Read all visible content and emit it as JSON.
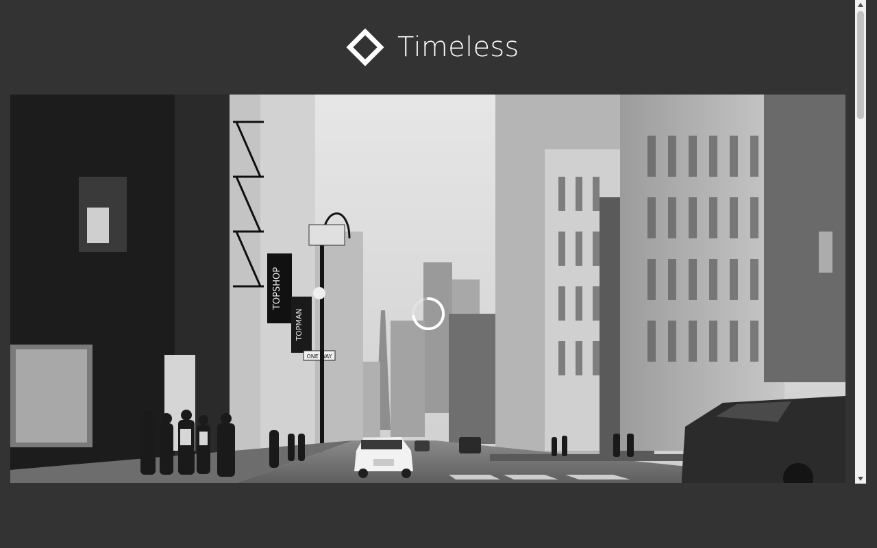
{
  "site": {
    "title": "Timeless"
  },
  "hero": {
    "signs": {
      "topshop": "TOPSHOP",
      "topman": "TOPMAN",
      "one_way": "ONE WAY"
    },
    "loading": true
  },
  "icons": {
    "logo": "diamond-outline-icon",
    "spinner": "loading-spinner-icon",
    "scroll_up": "scroll-up-arrow-icon",
    "scroll_down": "scroll-down-arrow-icon"
  },
  "colors": {
    "background": "#333333",
    "title": "#ffffff",
    "scrollbar_track": "#f1f1f1",
    "scrollbar_thumb": "#c1c1c1"
  }
}
